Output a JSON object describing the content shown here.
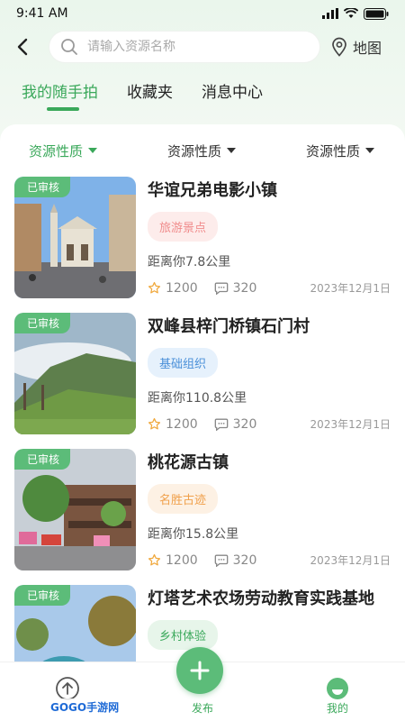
{
  "status": {
    "time": "9:41 AM"
  },
  "search": {
    "placeholder": "请输入资源名称"
  },
  "header": {
    "map_label": "地图"
  },
  "tabs": [
    {
      "label": "我的随手拍",
      "active": true
    },
    {
      "label": "收藏夹",
      "active": false
    },
    {
      "label": "消息中心",
      "active": false
    }
  ],
  "filters": [
    {
      "label": "资源性质",
      "active": true
    },
    {
      "label": "资源性质",
      "active": false
    },
    {
      "label": "资源性质",
      "active": false
    }
  ],
  "cards": [
    {
      "badge": "已审核",
      "title": "华谊兄弟电影小镇",
      "tag": "旅游景点",
      "tag_color": "#f08c8c",
      "tag_bg": "#fdeceb",
      "distance": "距离你7.8公里",
      "stars": "1200",
      "comments": "320",
      "date": "2023年12月1日"
    },
    {
      "badge": "已审核",
      "title": "双峰县梓门桥镇石门村",
      "tag": "基础组织",
      "tag_color": "#4a90d9",
      "tag_bg": "#e6f1fc",
      "distance": "距离你110.8公里",
      "stars": "1200",
      "comments": "320",
      "date": "2023年12月1日"
    },
    {
      "badge": "已审核",
      "title": "桃花源古镇",
      "tag": "名胜古迹",
      "tag_color": "#f0a04b",
      "tag_bg": "#fdf1e4",
      "distance": "距离你15.8公里",
      "stars": "1200",
      "comments": "320",
      "date": "2023年12月1日"
    },
    {
      "badge": "已审核",
      "title": "灯塔艺术农场劳动教育实践基地",
      "tag": "乡村体验",
      "tag_color": "#3aa85a",
      "tag_bg": "#e7f5ea",
      "distance": "",
      "stars": "",
      "comments": "",
      "date": ""
    }
  ],
  "bottom_nav": [
    {
      "label": "",
      "icon": "upload-icon"
    },
    {
      "label": "发布",
      "icon": "plus-icon"
    },
    {
      "label": "我的",
      "icon": "profile-icon"
    }
  ],
  "logo_text": "GOGO手游网",
  "colors": {
    "accent": "#3aa85a",
    "badge": "#5cbc79"
  }
}
